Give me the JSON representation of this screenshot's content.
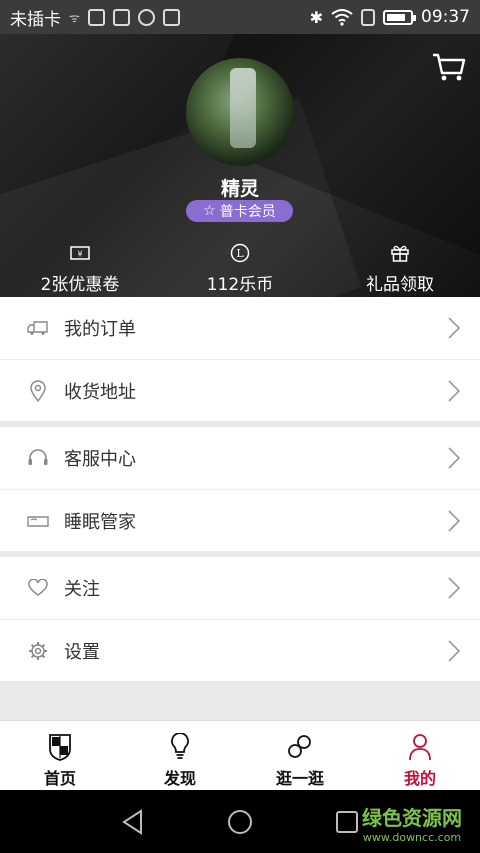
{
  "status_bar": {
    "carrier": "未插卡",
    "time": "09:37"
  },
  "profile": {
    "nickname": "精灵",
    "member_badge": "普卡会员"
  },
  "stats": [
    {
      "label": "2张优惠卷",
      "icon": "coupon-icon"
    },
    {
      "label": "112乐币",
      "icon": "lebi-coin-icon"
    },
    {
      "label": "礼品领取",
      "icon": "gift-icon"
    }
  ],
  "menu": {
    "group1": [
      {
        "label": "我的订单",
        "icon": "truck-icon"
      },
      {
        "label": "收货地址",
        "icon": "location-pin-icon"
      }
    ],
    "group2": [
      {
        "label": "客服中心",
        "icon": "headset-icon"
      },
      {
        "label": "睡眠管家",
        "icon": "bed-icon"
      }
    ],
    "group3": [
      {
        "label": "关注",
        "icon": "heart-icon"
      },
      {
        "label": "设置",
        "icon": "gear-icon"
      }
    ]
  },
  "tabs": [
    {
      "label": "首页",
      "icon": "shield-crest-icon",
      "active": false
    },
    {
      "label": "发现",
      "icon": "lightbulb-icon",
      "active": false
    },
    {
      "label": "逛一逛",
      "icon": "circles-icon",
      "active": false
    },
    {
      "label": "我的",
      "icon": "person-icon",
      "active": true
    }
  ],
  "watermark": {
    "title": "绿色资源网",
    "url": "www.downcc.com"
  },
  "colors": {
    "accent": "#c4113b",
    "badge": "#8b6cd1",
    "header_bg": "#1e1e1e"
  }
}
